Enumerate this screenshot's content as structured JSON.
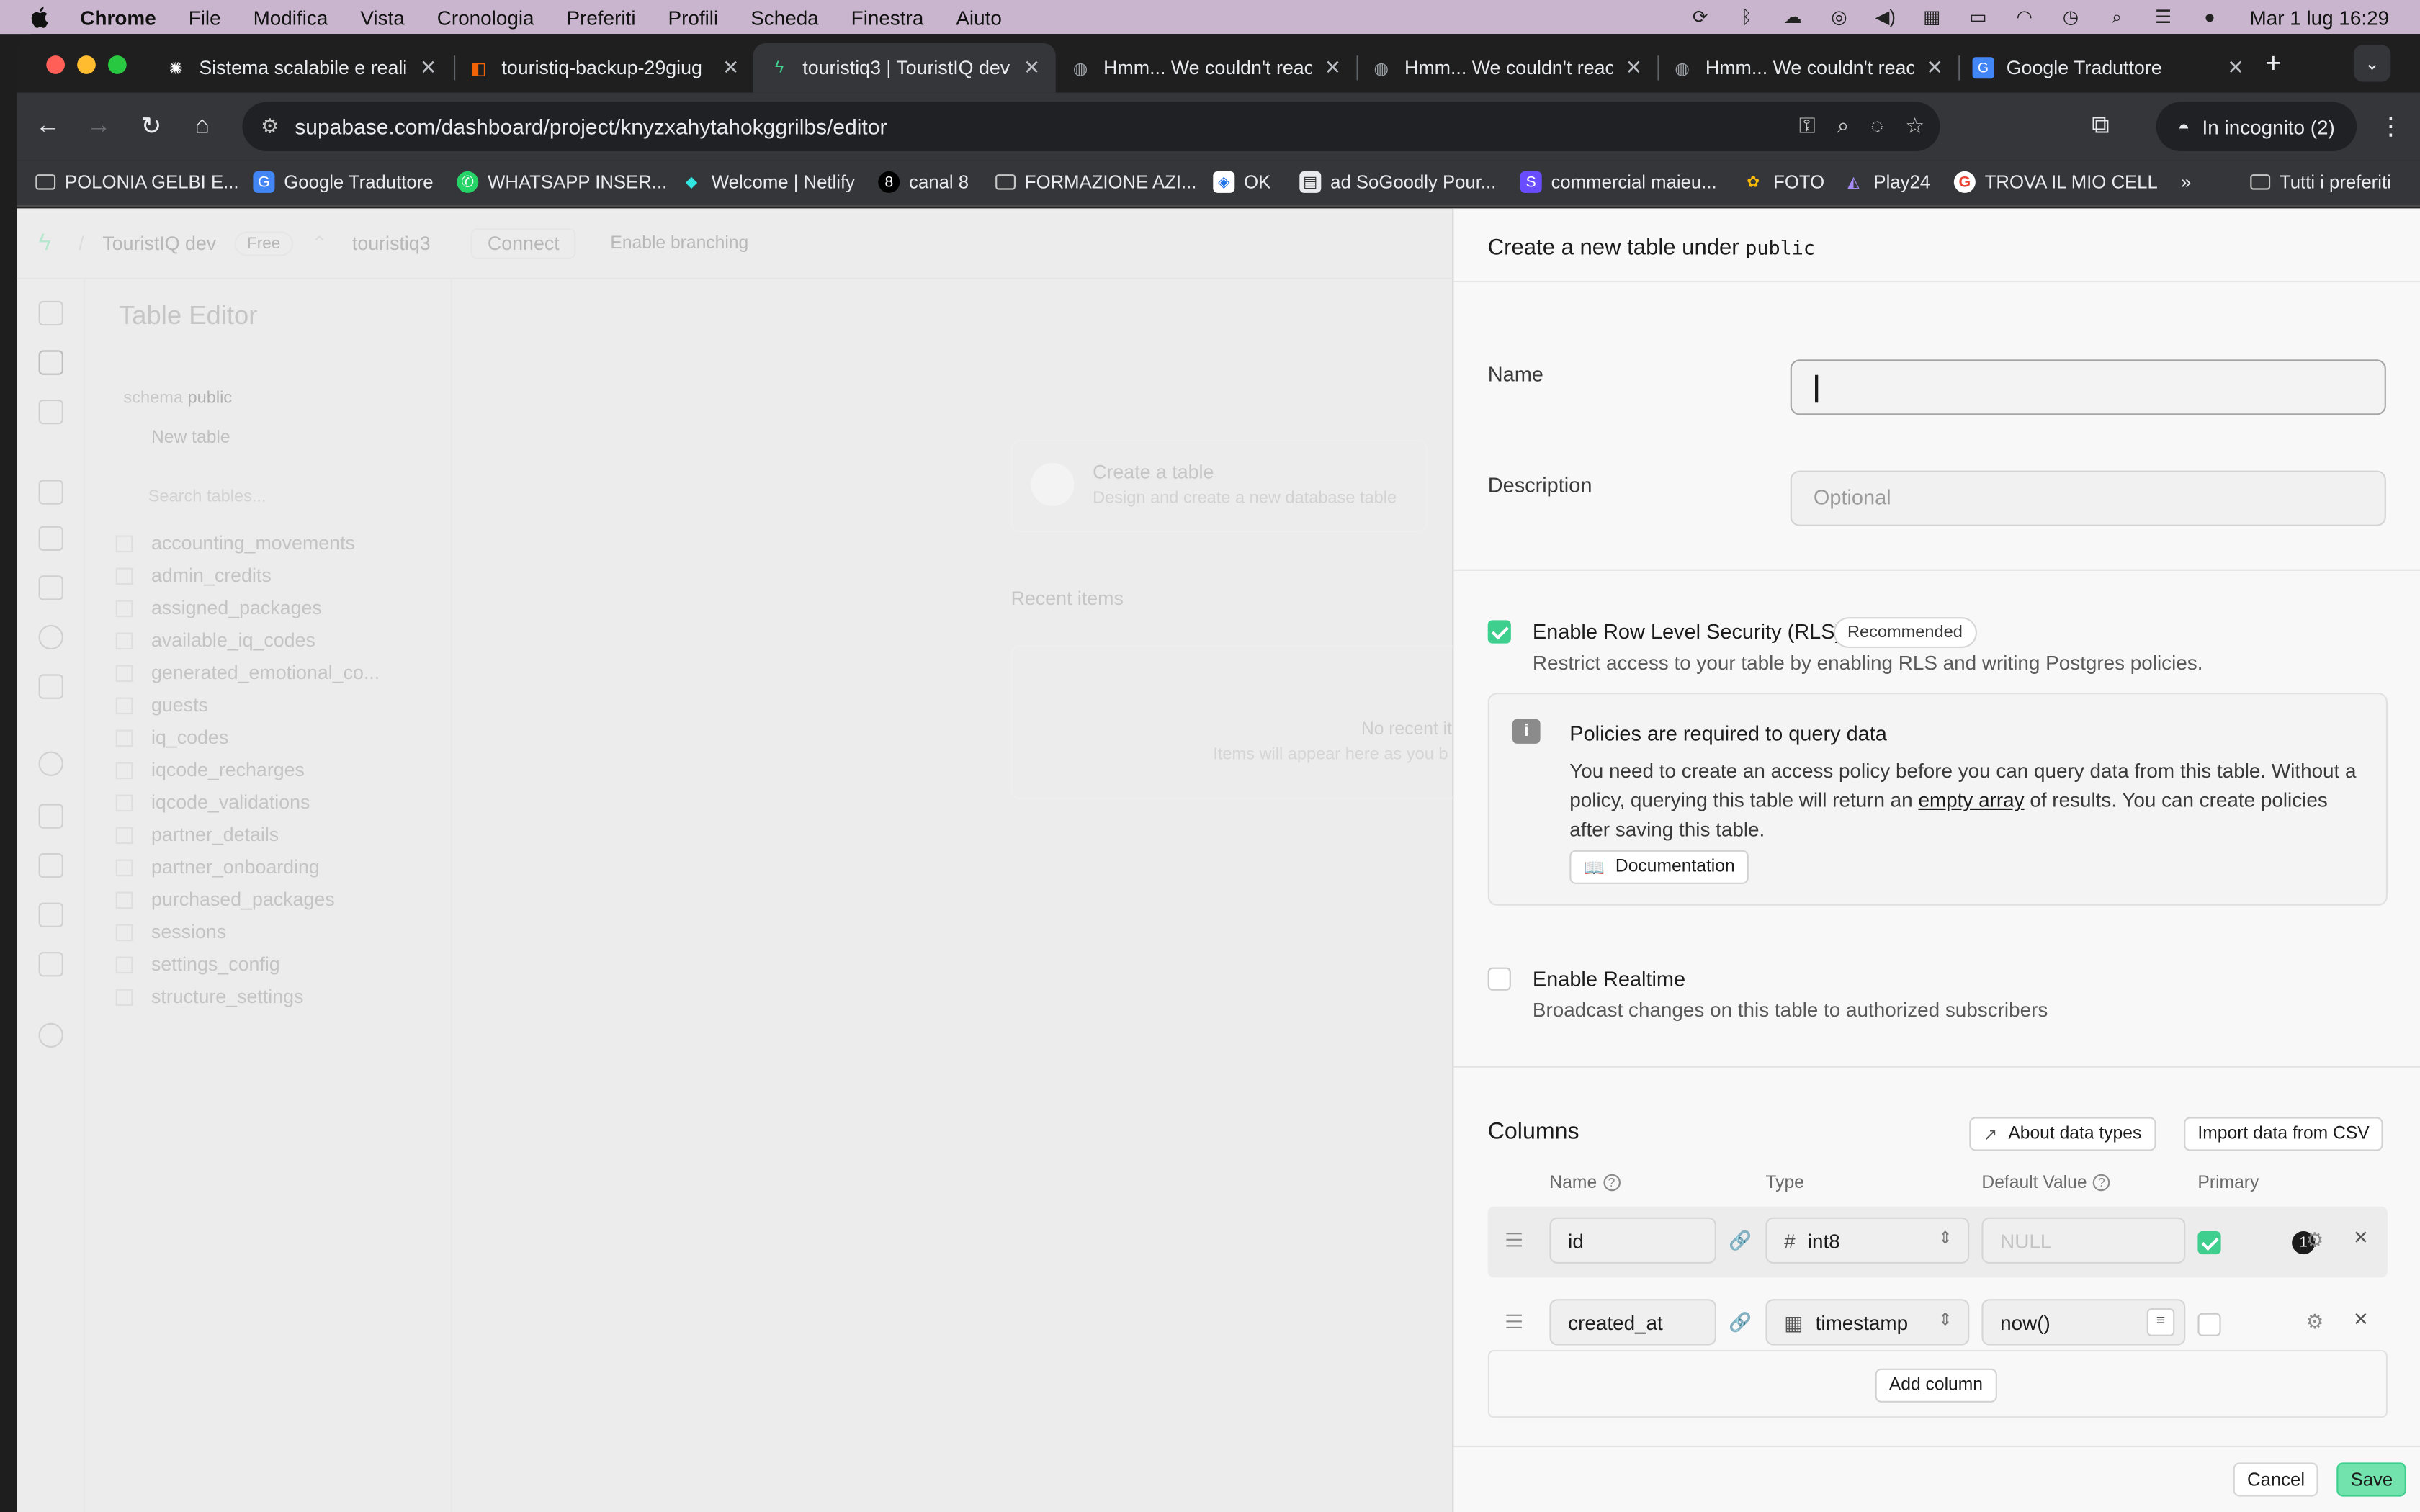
{
  "menubar": {
    "app": "Chrome",
    "items": [
      "File",
      "Modifica",
      "Vista",
      "Cronologia",
      "Preferiti",
      "Profili",
      "Scheda",
      "Finestra",
      "Aiuto"
    ],
    "clock": "Mar 1 lug  16:29"
  },
  "tabs": [
    {
      "title": "Sistema scalabile e reali",
      "icon": "openai-icon"
    },
    {
      "title": "touristiq-backup-29giug",
      "icon": "replit-icon"
    },
    {
      "title": "touristiq3 | TouristIQ dev",
      "icon": "supabase-icon"
    },
    {
      "title": "Hmm... We couldn't reac",
      "icon": "globe-icon"
    },
    {
      "title": "Hmm... We couldn't reac",
      "icon": "globe-icon"
    },
    {
      "title": "Hmm... We couldn't reac",
      "icon": "globe-icon"
    },
    {
      "title": "Google Traduttore",
      "icon": "translate-icon"
    }
  ],
  "address": {
    "url": "supabase.com/dashboard/project/knyzxahytahokggrilbs/editor",
    "incognito": "In incognito (2)"
  },
  "bookmarks": [
    {
      "label": "POLONIA GELBI E..."
    },
    {
      "label": "Google Traduttore"
    },
    {
      "label": "WHATSAPP INSER..."
    },
    {
      "label": "Welcome | Netlify"
    },
    {
      "label": "canal 8"
    },
    {
      "label": "FORMAZIONE AZI..."
    },
    {
      "label": "OK"
    },
    {
      "label": "ad SoGoodly Pour..."
    },
    {
      "label": "commercial maieu..."
    },
    {
      "label": "FOTO"
    },
    {
      "label": "Play24"
    },
    {
      "label": "TROVA IL MIO CELL"
    },
    {
      "label": "Tutti i preferiti"
    }
  ],
  "background": {
    "project": "TouristIQ dev",
    "plan": "Free",
    "branch": "touristiq3",
    "connect": "Connect",
    "branching": "Enable branching",
    "editor_title": "Table Editor",
    "schema_label": "schema",
    "schema_value": "public",
    "new_table": "New table",
    "search_placeholder": "Search tables...",
    "tables": [
      "accounting_movements",
      "admin_credits",
      "assigned_packages",
      "available_iq_codes",
      "generated_emotional_co...",
      "guests",
      "iq_codes",
      "iqcode_recharges",
      "iqcode_validations",
      "partner_details",
      "partner_onboarding",
      "purchased_packages",
      "sessions",
      "settings_config",
      "structure_settings"
    ],
    "create_card_title": "Create a table",
    "create_card_sub": "Design and create a new database table",
    "recent_title": "Recent items",
    "recent_empty": "No recent it",
    "recent_hint": "Items will appear here as you b"
  },
  "panel": {
    "title_prefix": "Create a new table under",
    "schema": "public",
    "name_label": "Name",
    "name_value": "",
    "description_label": "Description",
    "description_placeholder": "Optional",
    "rls_label": "Enable Row Level Security (RLS)",
    "rls_badge": "Recommended",
    "rls_sub": "Restrict access to your table by enabling RLS and writing Postgres policies.",
    "rls_checked": true,
    "alert_title": "Policies are required to query data",
    "alert_body_1": "You need to create an access policy before you can query data from this table. Without a policy, querying this table will return an",
    "alert_link": "empty array",
    "alert_body_2": "of results. You can create policies after saving this table.",
    "doc_button": "Documentation",
    "realtime_label": "Enable Realtime",
    "realtime_sub": "Broadcast changes on this table to authorized subscribers",
    "realtime_checked": false,
    "columns_title": "Columns",
    "about_types": "About data types",
    "import_csv": "Import data from CSV",
    "col_headers": {
      "name": "Name",
      "type": "Type",
      "default": "Default Value",
      "primary": "Primary"
    },
    "columns": [
      {
        "name": "id",
        "type": "int8",
        "type_icon": "#",
        "default": "NULL",
        "primary": true
      },
      {
        "name": "created_at",
        "type": "timestamp",
        "type_icon": "calendar",
        "default": "now()",
        "primary": false
      }
    ],
    "add_column": "Add column",
    "cancel": "Cancel",
    "save": "Save"
  },
  "colors": {
    "accent": "#3ecf8e",
    "save_bg": "#72e3ad",
    "menubar": "#c9b6ce"
  }
}
